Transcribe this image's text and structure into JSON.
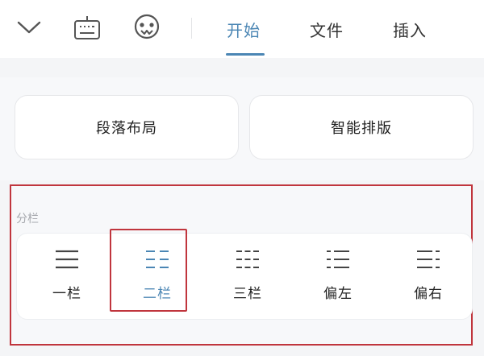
{
  "toolbar": {
    "icons": [
      "chevron-down-icon",
      "keyboard-icon",
      "smiley-icon"
    ],
    "tabs": [
      {
        "label": "开始",
        "active": true
      },
      {
        "label": "文件",
        "active": false
      },
      {
        "label": "插入",
        "active": false
      }
    ]
  },
  "layout_buttons": {
    "paragraph": "段落布局",
    "smart": "智能排版"
  },
  "columns": {
    "section_label": "分栏",
    "selected": "二栏",
    "options": [
      {
        "label": "一栏",
        "icon": "one-column-icon"
      },
      {
        "label": "二栏",
        "icon": "two-column-icon"
      },
      {
        "label": "三栏",
        "icon": "three-column-icon"
      },
      {
        "label": "偏左",
        "icon": "left-skewed-column-icon"
      },
      {
        "label": "偏右",
        "icon": "right-skewed-column-icon"
      }
    ]
  },
  "colors": {
    "accent": "#4b86b4",
    "highlight": "#c0353d"
  }
}
